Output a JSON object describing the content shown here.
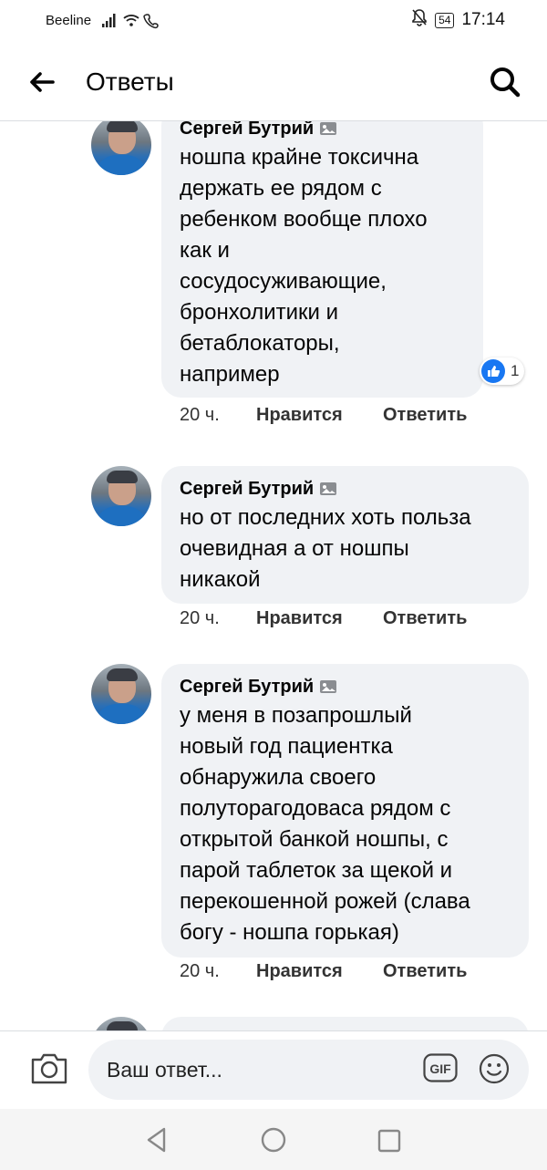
{
  "status_bar": {
    "carrier": "Beeline",
    "battery": "54",
    "time": "17:14"
  },
  "header": {
    "title": "Ответы"
  },
  "comments": [
    {
      "author": "Сергей Бутрий",
      "text_lines": [
        "ношпа крайне токсична",
        "держать ее рядом с",
        "ребенком вообще плохо",
        "как и",
        "сосудосуживающие,",
        "бронхолитики и",
        "бетаблокаторы,",
        "например"
      ],
      "time": "20 ч.",
      "like_label": "Нравится",
      "reply_label": "Ответить",
      "reaction_count": "1"
    },
    {
      "author": "Сергей Бутрий",
      "text_lines": [
        "но от последних хоть польза",
        "очевидная а от ношпы",
        "никакой"
      ],
      "time": "20 ч.",
      "like_label": "Нравится",
      "reply_label": "Ответить"
    },
    {
      "author": "Сергей Бутрий",
      "text_lines": [
        "у меня в позапрошлый",
        "новый год пациентка",
        "обнаружила своего",
        "полуторагодоваса рядом с",
        "открытой банкой ношпы, с",
        "парой таблеток за щекой и",
        "перекошенной рожей (слава",
        "богу - ношпа горькая)"
      ],
      "time": "20 ч.",
      "like_label": "Нравится",
      "reply_label": "Ответить"
    }
  ],
  "composer": {
    "placeholder": "Ваш ответ...",
    "gif_label": "GIF"
  },
  "icons": {
    "back": "arrow-left-icon",
    "search": "search-icon",
    "camera": "camera-icon",
    "gif": "gif-icon",
    "emoji": "smile-icon"
  },
  "colors": {
    "accent": "#1877f2",
    "bubble": "#f0f2f5"
  }
}
